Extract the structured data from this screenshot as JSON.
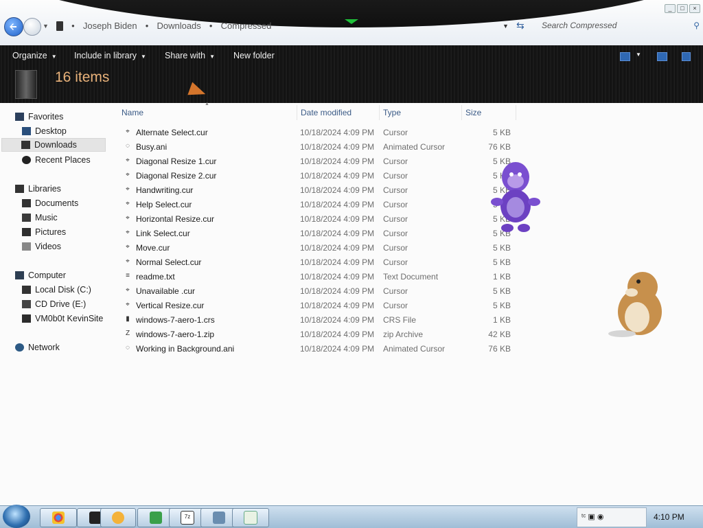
{
  "window": {
    "controls": [
      "_",
      "□",
      "×"
    ]
  },
  "breadcrumb": [
    "Joseph Biden",
    "Downloads",
    "Compressed"
  ],
  "search": {
    "placeholder": "Search Compressed"
  },
  "toolbar": {
    "organize": "Organize",
    "include_in_library": "Include in library",
    "share_with": "Share with",
    "new_folder": "New folder",
    "item_count": "16 items"
  },
  "nav": {
    "favorites": "Favorites",
    "desktop": "Desktop",
    "downloads": "Downloads",
    "recent_places": "Recent Places",
    "libraries": "Libraries",
    "documents": "Documents",
    "music": "Music",
    "pictures": "Pictures",
    "videos": "Videos",
    "computer": "Computer",
    "local_disk": "Local Disk (C:)",
    "cd_drive": "CD Drive (E:)",
    "share": "VM0b0t KevinSite",
    "network": "Network"
  },
  "columns": {
    "name": "Name",
    "date": "Date modified",
    "type": "Type",
    "size": "Size"
  },
  "files": [
    {
      "name": "Alternate Select.cur",
      "date": "10/18/2024 4:09 PM",
      "type": "Cursor",
      "size": "5 KB",
      "icon": "cursor-icon"
    },
    {
      "name": "Busy.ani",
      "date": "10/18/2024 4:09 PM",
      "type": "Animated Cursor",
      "size": "76 KB",
      "icon": "animated-cursor-icon"
    },
    {
      "name": "Diagonal Resize 1.cur",
      "date": "10/18/2024 4:09 PM",
      "type": "Cursor",
      "size": "5 KB",
      "icon": "cursor-icon"
    },
    {
      "name": "Diagonal Resize 2.cur",
      "date": "10/18/2024 4:09 PM",
      "type": "Cursor",
      "size": "5 KB",
      "icon": "cursor-icon"
    },
    {
      "name": "Handwriting.cur",
      "date": "10/18/2024 4:09 PM",
      "type": "Cursor",
      "size": "5 KB",
      "icon": "cursor-icon"
    },
    {
      "name": "Help Select.cur",
      "date": "10/18/2024 4:09 PM",
      "type": "Cursor",
      "size": "5 KB",
      "icon": "cursor-icon"
    },
    {
      "name": "Horizontal Resize.cur",
      "date": "10/18/2024 4:09 PM",
      "type": "Cursor",
      "size": "5 KB",
      "icon": "cursor-icon"
    },
    {
      "name": "Link Select.cur",
      "date": "10/18/2024 4:09 PM",
      "type": "Cursor",
      "size": "5 KB",
      "icon": "cursor-icon"
    },
    {
      "name": "Move.cur",
      "date": "10/18/2024 4:09 PM",
      "type": "Cursor",
      "size": "5 KB",
      "icon": "cursor-icon"
    },
    {
      "name": "Normal Select.cur",
      "date": "10/18/2024 4:09 PM",
      "type": "Cursor",
      "size": "5 KB",
      "icon": "cursor-icon"
    },
    {
      "name": "readme.txt",
      "date": "10/18/2024 4:09 PM",
      "type": "Text Document",
      "size": "1 KB",
      "icon": "text-file-icon"
    },
    {
      "name": "Unavailable .cur",
      "date": "10/18/2024 4:09 PM",
      "type": "Cursor",
      "size": "5 KB",
      "icon": "cursor-icon"
    },
    {
      "name": "Vertical Resize.cur",
      "date": "10/18/2024 4:09 PM",
      "type": "Cursor",
      "size": "5 KB",
      "icon": "cursor-icon"
    },
    {
      "name": "windows-7-aero-1.crs",
      "date": "10/18/2024 4:09 PM",
      "type": "CRS File",
      "size": "1 KB",
      "icon": "crs-file-icon"
    },
    {
      "name": "windows-7-aero-1.zip",
      "date": "10/18/2024 4:09 PM",
      "type": "zip Archive",
      "size": "42 KB",
      "icon": "zip-file-icon"
    },
    {
      "name": "Working in Background.ani",
      "date": "10/18/2024 4:09 PM",
      "type": "Animated Cursor",
      "size": "76 KB",
      "icon": "animated-cursor-icon"
    }
  ],
  "taskbar": {
    "clock": "4:10 PM"
  },
  "colors": {
    "item_count": "#e9b27a",
    "column_header": "#3a5a86",
    "toolbar_bg": "#161616"
  }
}
